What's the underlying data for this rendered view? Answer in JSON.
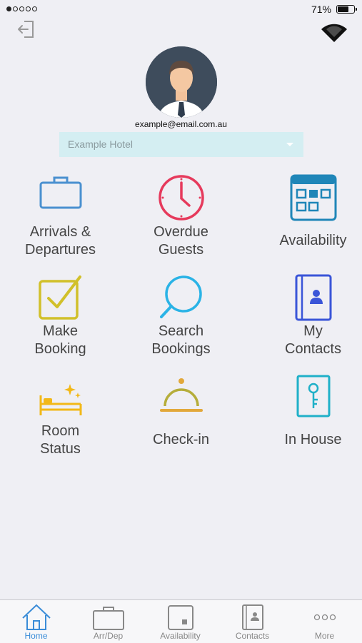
{
  "status_bar": {
    "battery": "71%",
    "battery_level": 0.71
  },
  "profile": {
    "email": "example@email.com.au"
  },
  "hotel_select": {
    "value": "Example Hotel"
  },
  "tiles": [
    {
      "label": "Arrivals &\nDepartures",
      "icon": "briefcase-icon",
      "color": "#4a90d0"
    },
    {
      "label": "Overdue\nGuests",
      "icon": "clock-icon",
      "color": "#e63a5c"
    },
    {
      "label": "Availability",
      "icon": "calendar-icon",
      "color": "#1f86b8"
    },
    {
      "label": "Make\nBooking",
      "icon": "checkbox-icon",
      "color": "#d1c02a"
    },
    {
      "label": "Search\nBookings",
      "icon": "magnifier-icon",
      "color": "#2ab3e6"
    },
    {
      "label": "My\nContacts",
      "icon": "contacts-book-icon",
      "color": "#3a55d8"
    },
    {
      "label": "Room\nStatus",
      "icon": "bed-icon",
      "color": "#f2b818"
    },
    {
      "label": "Check-in",
      "icon": "service-bell-icon",
      "color": "#e2a83a"
    },
    {
      "label": "In House",
      "icon": "door-key-icon",
      "color": "#1fb0c8"
    }
  ],
  "tab_bar": [
    {
      "label": "Home",
      "active": true
    },
    {
      "label": "Arr/Dep",
      "active": false
    },
    {
      "label": "Availability",
      "active": false
    },
    {
      "label": "Contacts",
      "active": false
    },
    {
      "label": "More",
      "active": false
    }
  ]
}
